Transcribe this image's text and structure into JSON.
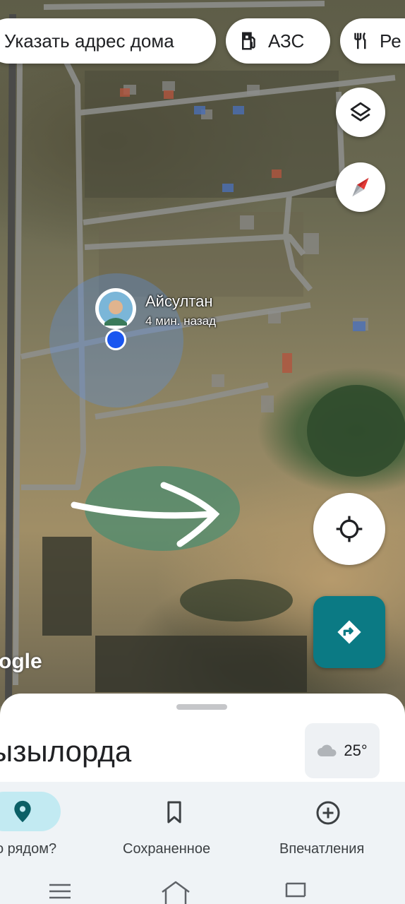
{
  "top_chips": {
    "address_label": "Указать адрес дома",
    "gas_label": "АЗС",
    "restaurants_label": "Ре"
  },
  "map": {
    "friend": {
      "name": "Айсултан",
      "last_seen": "4 мин. назад"
    },
    "attribution": "ogle"
  },
  "sheet": {
    "place_title": "ызылорда",
    "weather_temp": "25°"
  },
  "bottom_nav": {
    "items": [
      {
        "label": "о рядом?",
        "icon": "pin-icon",
        "active": true
      },
      {
        "label": "Сохраненное",
        "icon": "bookmark-icon",
        "active": false
      },
      {
        "label": "Впечатления",
        "icon": "add-circle-icon",
        "active": false
      }
    ]
  },
  "colors": {
    "accent_teal": "#0b7a84",
    "active_pill": "#c2eaf2",
    "location_dot": "#1a56f0"
  }
}
